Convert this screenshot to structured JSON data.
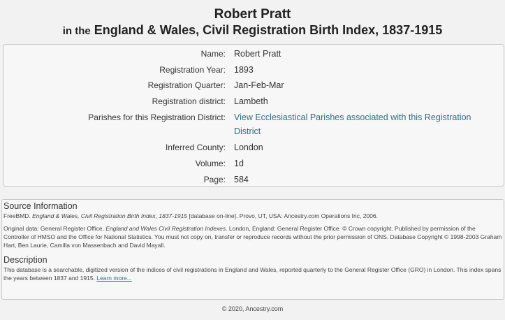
{
  "header": {
    "name": "Robert Pratt",
    "prefix": "in the",
    "collection": "England & Wales, Civil Registration Birth Index, 1837-1915"
  },
  "record": {
    "fields": [
      {
        "label": "Name:",
        "value": "Robert Pratt"
      },
      {
        "label": "Registration Year:",
        "value": "1893"
      },
      {
        "label": "Registration Quarter:",
        "value": "Jan-Feb-Mar"
      },
      {
        "label": "Registration district:",
        "value": "Lambeth"
      },
      {
        "label": "Parishes for this Registration District:",
        "value": "View Ecclesiastical Parishes associated with this Registration District"
      },
      {
        "label": "Inferred County:",
        "value": "London"
      },
      {
        "label": "Volume:",
        "value": "1d"
      },
      {
        "label": "Page:",
        "value": "584"
      }
    ]
  },
  "source": {
    "heading": "Source Information",
    "citation_pre": "FreeBMD.",
    "citation_title": "England & Wales, Civil Registration Birth Index, 1837-1915",
    "citation_post": "[database on-line]. Provo, UT, USA: Ancestry.com Operations Inc, 2006.",
    "original_pre": "Original data: General Register Office.",
    "original_title": "England and Wales Civil Registration Indexes",
    "original_post": ". London, England: General Register Office. © Crown copyright. Published by permission of the Controller of HMSO and the Office for National Statistics. You must not copy on, transfer or reproduce records without the prior permission of ONS. Database Copyright © 1998-2003 Graham Hart, Ben Laurie, Camilla von Massenbach and David Mayall."
  },
  "description": {
    "heading": "Description",
    "text": "This database is a searchable, digitized version of the indices of civil registrations in England and Wales, reported quarterly to the General Register Office (GRO) in London. This index spans the years between 1837 and 1915.",
    "link": "Learn more..."
  },
  "footer": {
    "copyright": "© 2020, Ancestry.com"
  }
}
